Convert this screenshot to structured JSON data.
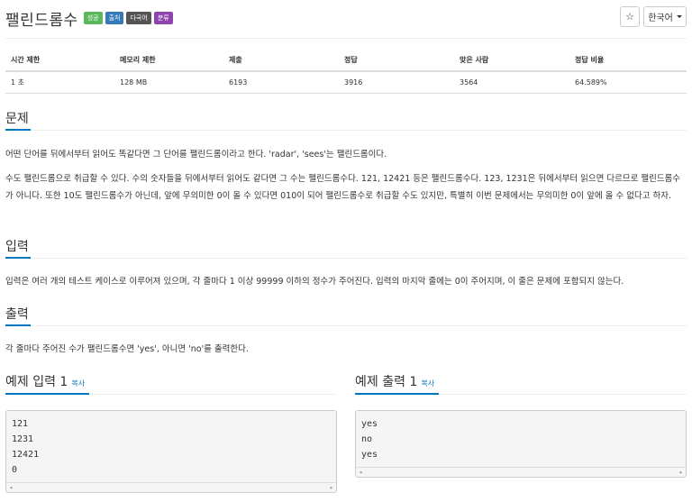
{
  "title": "팰린드롬수",
  "labels": [
    {
      "text": "성공",
      "color": "#5cb85c"
    },
    {
      "text": "출처",
      "color": "#337ab7"
    },
    {
      "text": "다국어",
      "color": "#555555"
    },
    {
      "text": "분류",
      "color": "#8e44ad"
    }
  ],
  "controls": {
    "star_icon": "☆",
    "language": "한국어"
  },
  "info_table": {
    "headers": [
      "시간 제한",
      "메모리 제한",
      "제출",
      "정답",
      "맞은 사람",
      "정답 비율"
    ],
    "values": [
      "1 초",
      "128 MB",
      "6193",
      "3916",
      "3564",
      "64.589%"
    ]
  },
  "sections": {
    "problem": {
      "heading": "문제",
      "paragraphs": [
        "어떤 단어를 뒤에서부터 읽어도 똑같다면 그 단어를 팰린드롬이라고 한다. 'radar', 'sees'는 팰린드롬이다.",
        "수도 팰린드롬으로 취급할 수 있다. 수의 숫자들을 뒤에서부터 읽어도 같다면 그 수는 팰린드롬수다. 121, 12421 등은 팰린드롬수다. 123, 1231은 뒤에서부터 읽으면 다르므로 팰린드롬수가 아니다. 또한 10도 팰린드롬수가 아닌데, 앞에 무의미한 0이 올 수 있다면 010이 되어 팰린드롬수로 취급할 수도 있지만, 특별히 이번 문제에서는 무의미한 0이 앞에 올 수 없다고 하자."
      ]
    },
    "input": {
      "heading": "입력",
      "text": "입력은 여러 개의 테스트 케이스로 이루어져 있으며, 각 줄마다 1 이상 99999 이하의 정수가 주어진다. 입력의 마지막 줄에는 0이 주어지며, 이 줄은 문제에 포함되지 않는다."
    },
    "output": {
      "heading": "출력",
      "text": "각 줄마다 주어진 수가 팰린드롬수면 'yes', 아니면 'no'를 출력한다."
    }
  },
  "samples": {
    "input": {
      "heading": "예제 입력 1",
      "copy": "복사",
      "lines": [
        "121",
        "1231",
        "12421",
        "0"
      ]
    },
    "output": {
      "heading": "예제 출력 1",
      "copy": "복사",
      "lines": [
        "yes",
        "no",
        "yes"
      ]
    }
  },
  "scroll_icons": {
    "left": "◂",
    "right": "▸"
  },
  "accent_color": "#0076c0"
}
